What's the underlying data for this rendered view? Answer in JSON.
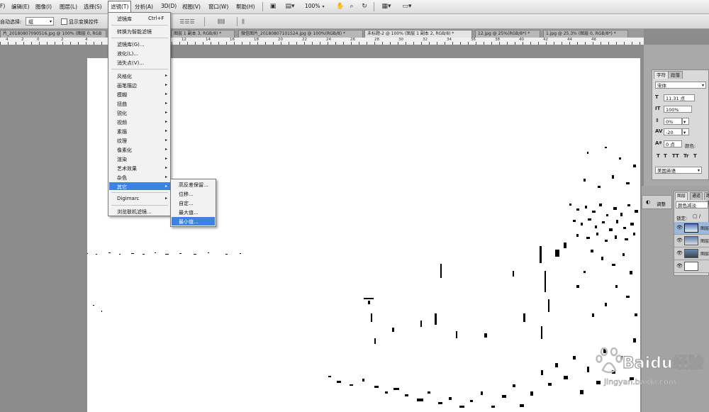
{
  "menubar": {
    "items": [
      "编辑(E)",
      "图像(I)",
      "图层(L)",
      "选择(S)",
      "滤镜(T)",
      "分析(A)",
      "3D(D)",
      "视图(V)",
      "窗口(W)",
      "帮助(H)"
    ],
    "partial_first": "F)",
    "zoom_value": "100%"
  },
  "options": {
    "auto_select_label": "自动选择:",
    "auto_select_value": "组",
    "show_transform_label": "显示变换控件"
  },
  "tabs": [
    {
      "label": "片_20180807090516.jpg @ 100% (图层 0, RGB"
    },
    {
      "label": "图层 1 副本 3, RGB/8) *"
    },
    {
      "label": "微信图片_20180807101524.jpg @ 100%(RGB/8) *"
    },
    {
      "label": "未标题-2 @ 100% (图层 1 副本 2, RGB/8) *"
    },
    {
      "label": "12.jpg @ 25%(RGB/8*) *"
    },
    {
      "label": "1.jpg @ 25.3% (图层 0, RGB/8*) *"
    }
  ],
  "ruler_numbers": [
    "4",
    "2",
    "0",
    "2",
    "4",
    "6",
    "8",
    "10",
    "12",
    "14",
    "16",
    "18",
    "20",
    "22",
    "24",
    "26",
    "28",
    "30",
    "32",
    "34",
    "36",
    "38",
    "40",
    "42",
    "44",
    "46"
  ],
  "filter_menu": {
    "title": "滤镜(T)",
    "last_filter": "滤镜库",
    "shortcut": "Ctrl+F",
    "smart_filter": "转换为智能滤镜",
    "gallery": "滤镜库(G)...",
    "liquify": "液化(L)...",
    "vanishing": "消失点(V)...",
    "groups": [
      "风格化",
      "画笔描边",
      "模糊",
      "扭曲",
      "锐化",
      "视频",
      "素描",
      "纹理",
      "像素化",
      "渲染",
      "艺术效果",
      "杂色",
      "其它"
    ],
    "digimarc": "Digimarc",
    "browse": "浏览联机滤镜..."
  },
  "other_submenu": {
    "items": [
      "高反差保留...",
      "位移...",
      "自定...",
      "最大值...",
      "最小值..."
    ]
  },
  "char_panel": {
    "tab_char": "字符",
    "tab_para": "段落",
    "font_family": "宋体",
    "font_size": "11.31 点",
    "vscale": "100%",
    "leading": "0%",
    "tracking": "-20",
    "baseline": "0 点",
    "color_label": "颜色:",
    "style_buttons": [
      "T",
      "T",
      "TT",
      "Tr",
      "T"
    ],
    "language": "美国英语"
  },
  "layers_panel": {
    "adjust_label": "调整",
    "tab_layers": "图层",
    "tab_channels": "通道",
    "tab_paths": "路径",
    "blend_mode": "颜色减淡",
    "lock_label": "锁定:",
    "layer_names": [
      "图层",
      "图层",
      "图层",
      ""
    ]
  },
  "watermark": {
    "brand": "Baidu经验",
    "url": "jingyan.baidu.com"
  }
}
